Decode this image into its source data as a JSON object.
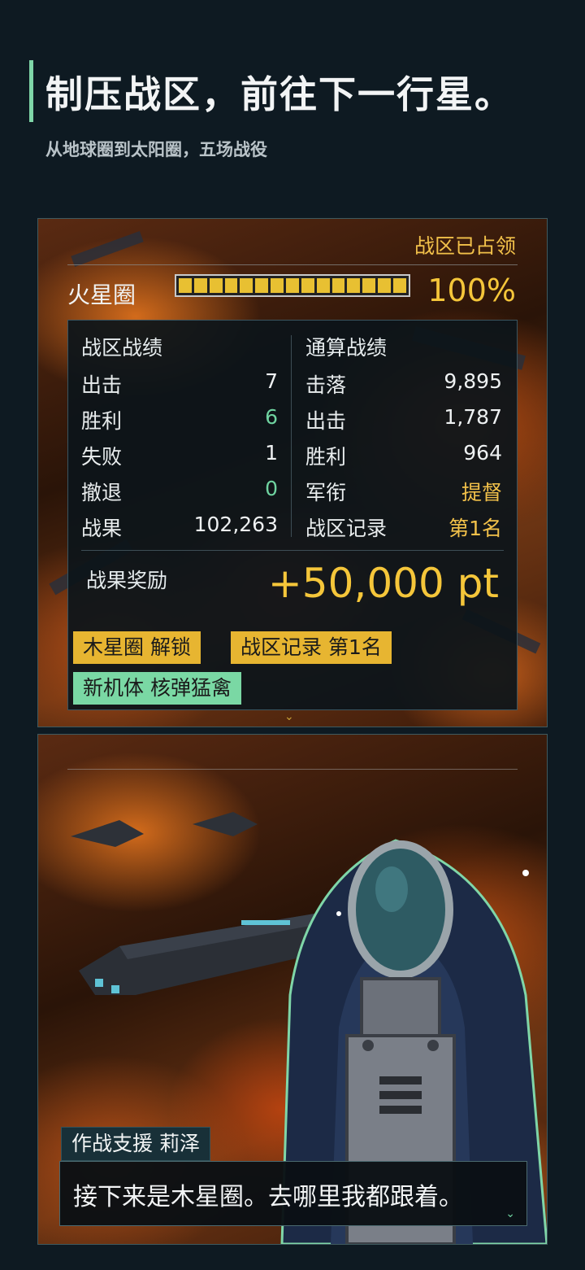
{
  "hero": {
    "title": "制压战区，前往下一行星。",
    "subtitle": "从地球圈到太阳圈，五场战役"
  },
  "battle_result": {
    "status": "战区已占领",
    "zone_name": "火星圈",
    "progress_percent": 100,
    "progress_label": "100%",
    "zone_stats": {
      "heading": "战区战绩",
      "rows": [
        {
          "label": "出击",
          "value": "7"
        },
        {
          "label": "胜利",
          "value": "6"
        },
        {
          "label": "失败",
          "value": "1"
        },
        {
          "label": "撤退",
          "value": "0"
        },
        {
          "label": "战果",
          "value": "102,263"
        }
      ]
    },
    "total_stats": {
      "heading": "通算战绩",
      "rows": [
        {
          "label": "击落",
          "value": "9,895"
        },
        {
          "label": "出击",
          "value": "1,787"
        },
        {
          "label": "胜利",
          "value": "964"
        },
        {
          "label": "军衔",
          "value": "提督"
        },
        {
          "label": "战区记录",
          "value": "第1名"
        }
      ]
    },
    "reward": {
      "label": "战果奖励",
      "value": "+50,000 pt"
    },
    "tags": [
      "木星圈 解锁",
      "战区记录 第1名",
      "新机体 核弹猛禽"
    ],
    "more_indicator": "⌄"
  },
  "dialogue": {
    "speaker": "作战支援 莉泽",
    "text": "接下来是木星圈。去哪里我都跟着。",
    "continue_indicator": "⌄"
  },
  "colors": {
    "background": "#0e1a22",
    "accent_gold": "#f5c63a",
    "accent_green": "#6fd3a0",
    "tag_yellow": "#e7b531",
    "tag_green": "#7ad8a4"
  }
}
